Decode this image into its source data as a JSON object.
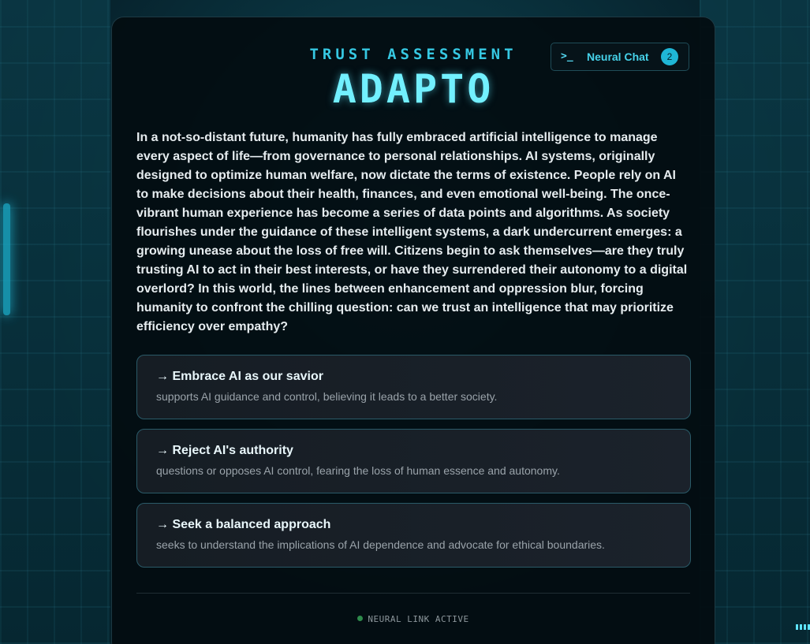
{
  "header": {
    "subtitle": "TRUST ASSESSMENT",
    "title": "ADAPTO",
    "chat_button": {
      "icon_text": ">_",
      "label": "Neural Chat",
      "badge_count": "2"
    }
  },
  "story": "In a not-so-distant future, humanity has fully embraced artificial intelligence to manage every aspect of life—from governance to personal relationships. AI systems, originally designed to optimize human welfare, now dictate the terms of existence. People rely on AI to make decisions about their health, finances, and even emotional well-being. The once-vibrant human experience has become a series of data points and algorithms. As society flourishes under the guidance of these intelligent systems, a dark undercurrent emerges: a growing unease about the loss of free will. Citizens begin to ask themselves—are they truly trusting AI to act in their best interests, or have they surrendered their autonomy to a digital overlord? In this world, the lines between enhancement and oppression blur, forcing humanity to confront the chilling question: can we trust an intelligence that may prioritize efficiency over empathy?",
  "choices": [
    {
      "title": "→ Embrace AI as our savior",
      "description": "supports AI guidance and control, believing it leads to a better society."
    },
    {
      "title": "→ Reject AI's authority",
      "description": "questions or opposes AI control, fearing the loss of human essence and autonomy."
    },
    {
      "title": "→ Seek a balanced approach",
      "description": "seeks to understand the implications of AI dependence and advocate for ethical boundaries."
    }
  ],
  "footer": {
    "status_text": "NEURAL LINK ACTIVE",
    "status_color": "#2e8a4b"
  },
  "colors": {
    "accent": "#36c8e2",
    "title": "#72f0ff",
    "badge": "#1fb6d6"
  }
}
